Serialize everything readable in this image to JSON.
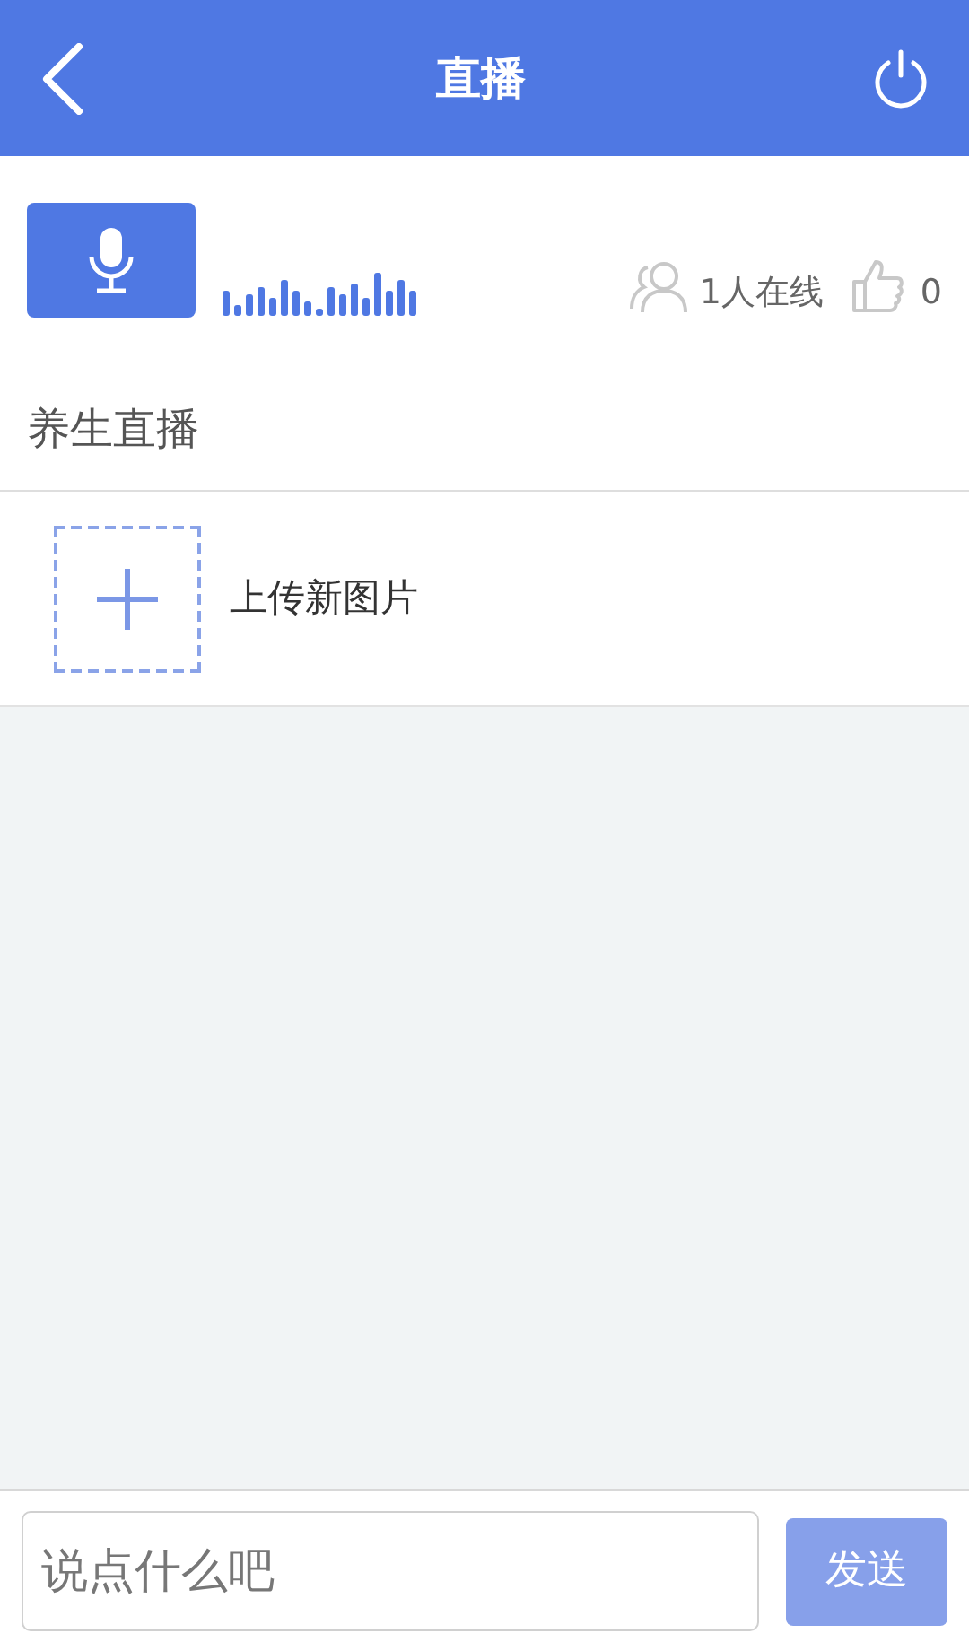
{
  "header": {
    "title": "直播"
  },
  "stats": {
    "online": "1人在线",
    "likes": "0"
  },
  "section_title": "养生直播",
  "upload": {
    "label": "上传新图片"
  },
  "composer": {
    "placeholder": "说点什么吧",
    "send": {
      "label": "发送",
      "disabled": true
    }
  }
}
